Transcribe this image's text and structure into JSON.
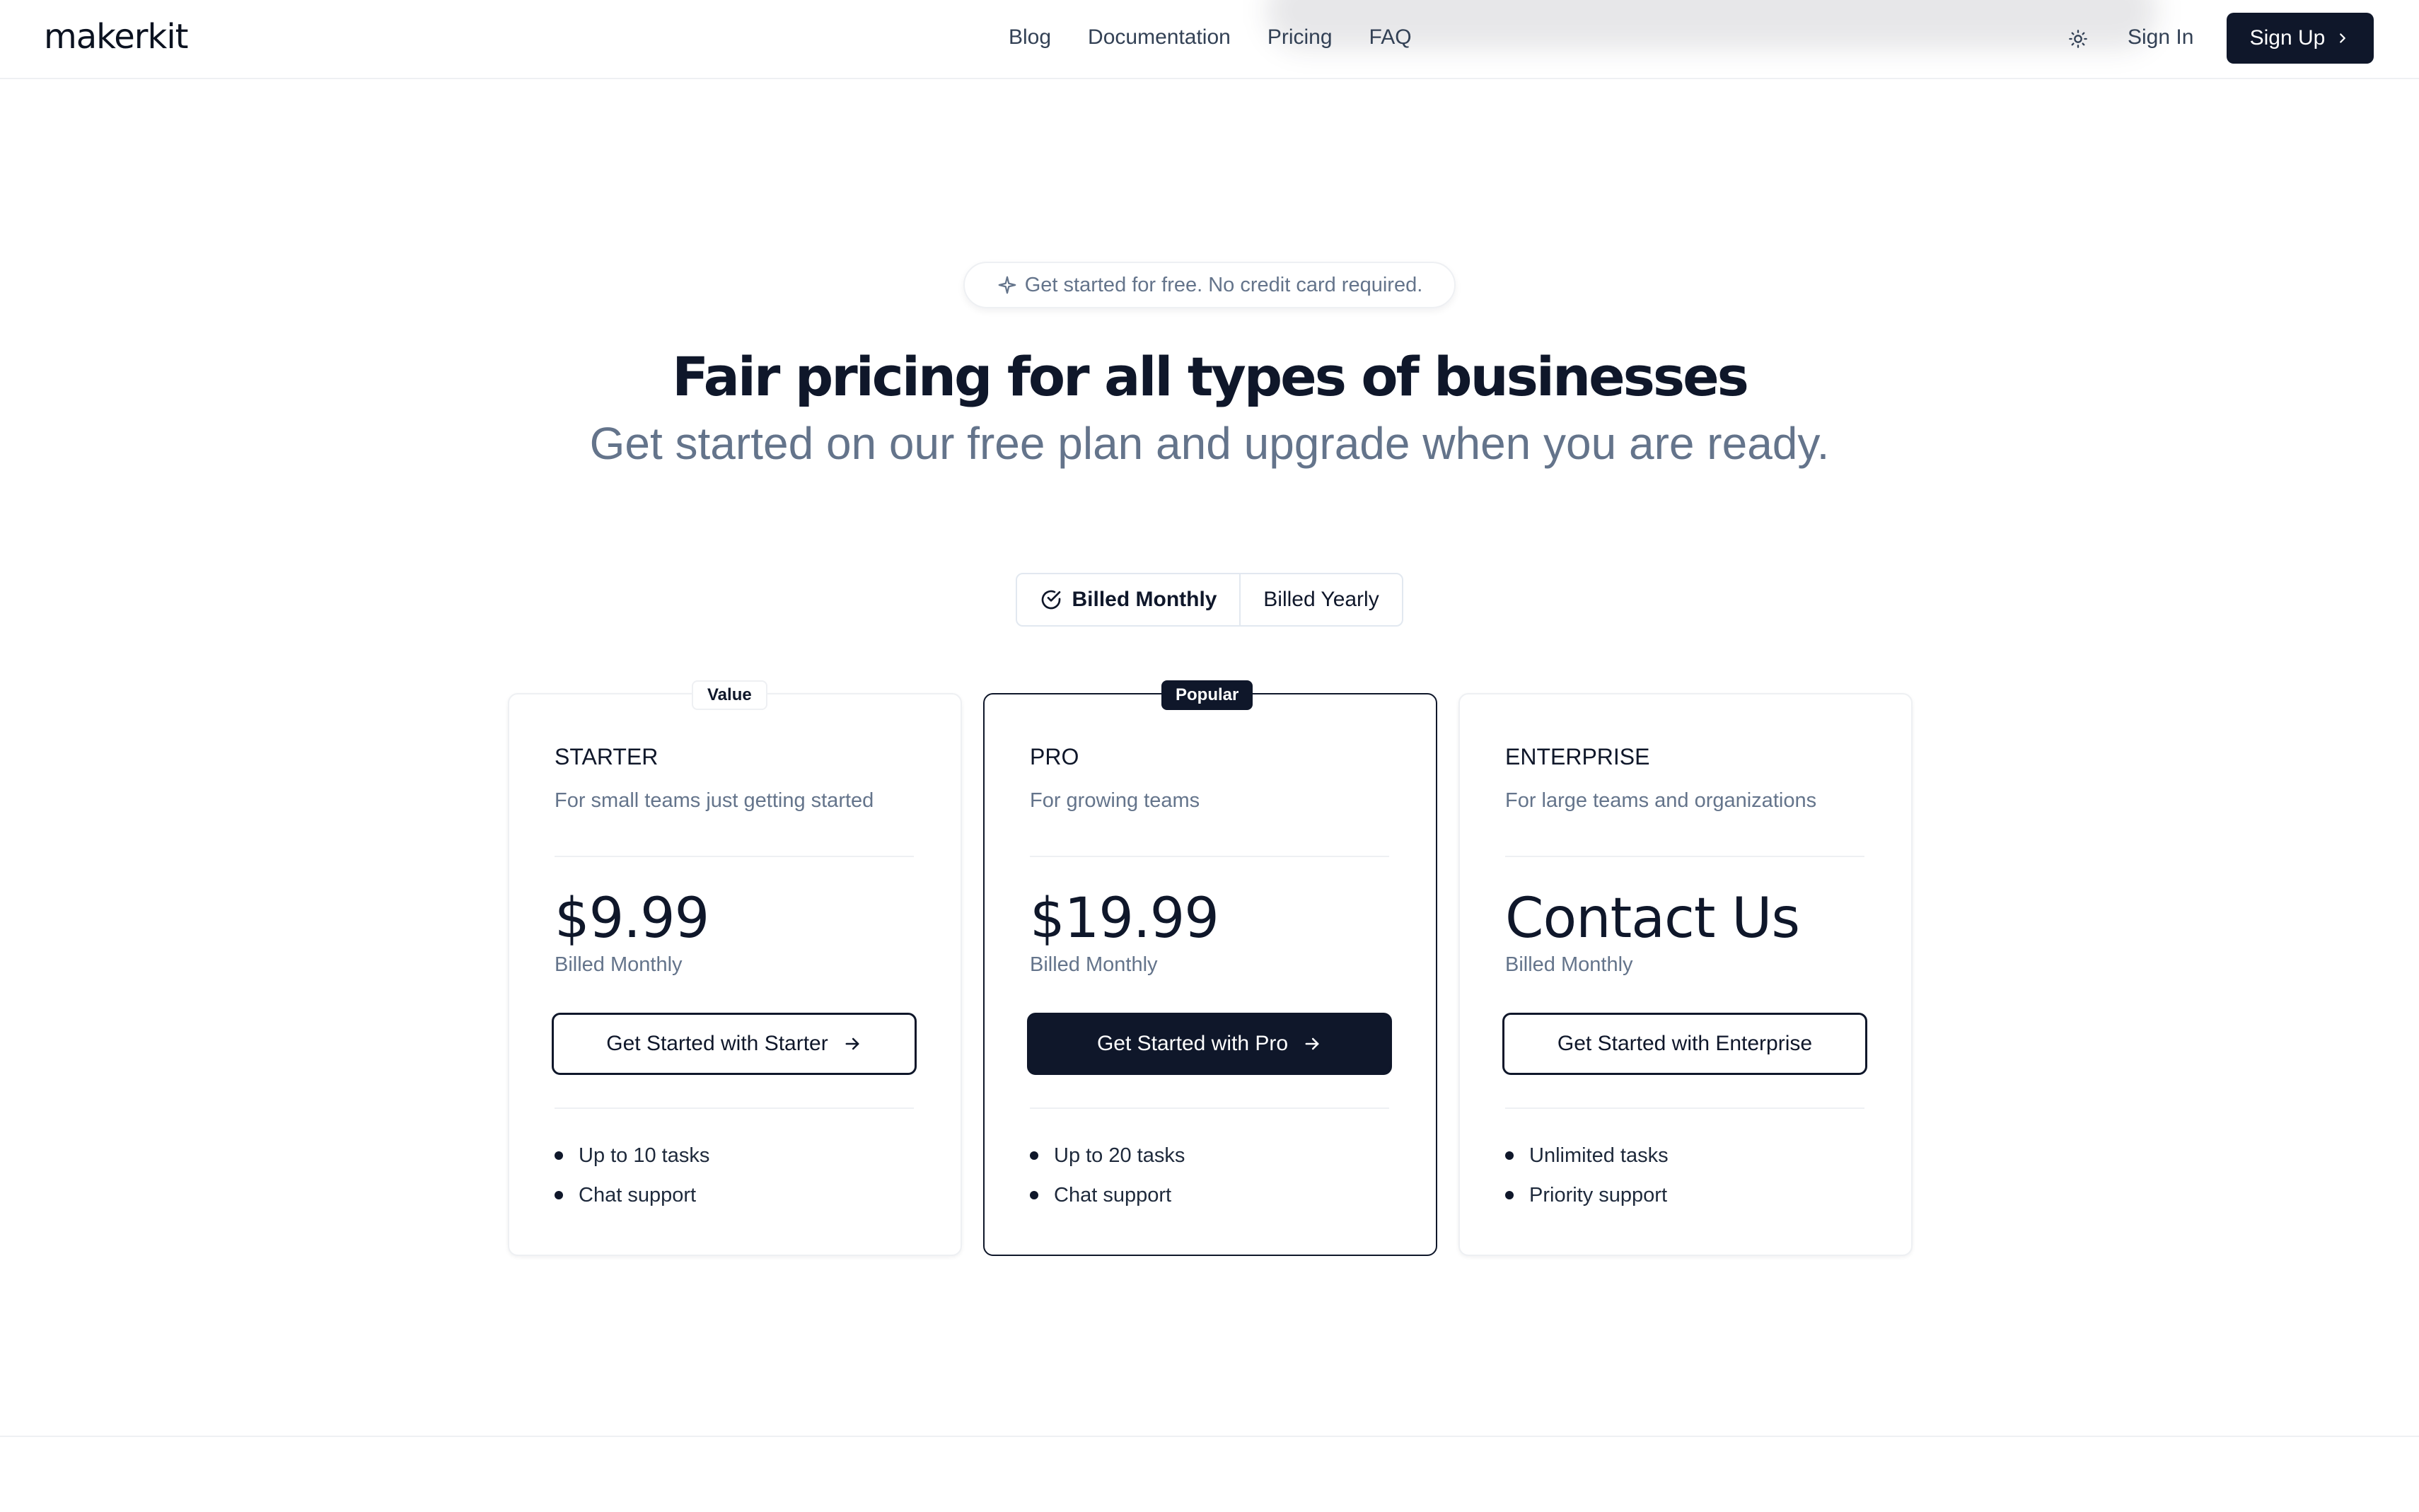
{
  "header": {
    "logo": "makerkit",
    "nav": [
      "Blog",
      "Documentation",
      "Pricing",
      "FAQ"
    ],
    "sign_in": "Sign In",
    "sign_up": "Sign Up"
  },
  "hero": {
    "pill_text": "Get started for free. No credit card required.",
    "title": "Fair pricing for all types of businesses",
    "subtitle": "Get started on our free plan and upgrade when you are ready."
  },
  "billing": {
    "monthly": "Billed Monthly",
    "yearly": "Billed Yearly",
    "selected": "monthly"
  },
  "plans": [
    {
      "badge": "Value",
      "name": "STARTER",
      "description": "For small teams just getting started",
      "price": "$9.99",
      "billed": "Billed Monthly",
      "cta": "Get Started with Starter",
      "features": [
        "Up to 10 tasks",
        "Chat support"
      ]
    },
    {
      "badge": "Popular",
      "name": "PRO",
      "description": "For growing teams",
      "price": "$19.99",
      "billed": "Billed Monthly",
      "cta": "Get Started with Pro",
      "features": [
        "Up to 20 tasks",
        "Chat support"
      ]
    },
    {
      "badge": "",
      "name": "ENTERPRISE",
      "description": "For large teams and organizations",
      "price": "Contact Us",
      "billed": "Billed Monthly",
      "cta": "Get Started with Enterprise",
      "features": [
        "Unlimited tasks",
        "Priority support"
      ]
    }
  ],
  "colors": {
    "primary": "#0f172a",
    "muted_text": "#64748b",
    "border": "#eef0f3"
  }
}
